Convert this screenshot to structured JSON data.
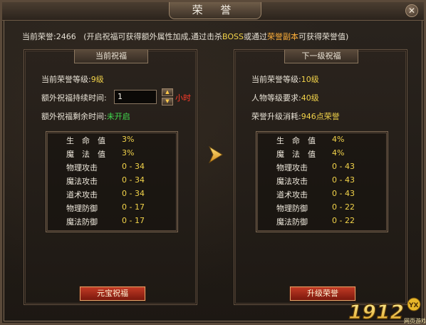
{
  "window": {
    "title": "荣 誉",
    "close": "✕"
  },
  "header": {
    "honor_label": "当前荣誉:",
    "honor_value": "2466",
    "note_prefix": "(开启祝福可获得额外属性加成,通过击杀",
    "note_boss": "BOSS",
    "note_mid": "或通过",
    "note_dungeon": "荣誉副本",
    "note_suffix": "可获得荣誉值)"
  },
  "left": {
    "header": "当前祝福",
    "level_label": "当前荣誉等级:",
    "level_value": "9级",
    "duration_label": "额外祝福持续时间:",
    "duration_input": "1",
    "duration_unit": "小时",
    "remain_label": "额外祝福剩余时间:",
    "remain_value": "未开启",
    "stats": [
      {
        "name": "生　命　值",
        "value": "3%"
      },
      {
        "name": "魔　法　值",
        "value": "3%"
      },
      {
        "name": "物理攻击",
        "value": "0 - 34"
      },
      {
        "name": "魔法攻击",
        "value": "0 - 34"
      },
      {
        "name": "道术攻击",
        "value": "0 - 34"
      },
      {
        "name": "物理防御",
        "value": "0 - 17"
      },
      {
        "name": "魔法防御",
        "value": "0 - 17"
      }
    ],
    "button": "元宝祝福"
  },
  "right": {
    "header": "下一级祝福",
    "level_label": "当前荣誉等级:",
    "level_value": "10级",
    "req_label": "人物等级要求:",
    "req_value": "40级",
    "cost_label": "荣誉升级消耗:",
    "cost_value": "946点荣誉",
    "stats": [
      {
        "name": "生　命　值",
        "value": "4%"
      },
      {
        "name": "魔　法　值",
        "value": "4%"
      },
      {
        "name": "物理攻击",
        "value": "0 - 43"
      },
      {
        "name": "魔法攻击",
        "value": "0 - 43"
      },
      {
        "name": "道术攻击",
        "value": "0 - 43"
      },
      {
        "name": "物理防御",
        "value": "0 - 22"
      },
      {
        "name": "魔法防御",
        "value": "0 - 22"
      }
    ],
    "button": "升级荣誉"
  },
  "logo": {
    "number": "1912",
    "badge": "YX",
    "sub": "网页游戏"
  },
  "colors": {
    "gold": "#f2d34a",
    "red": "#ff3b2a",
    "green": "#41d94d",
    "button": "#c23a24"
  },
  "icons": {
    "close": "close-icon",
    "arrow": "arrow-right-icon",
    "spin_up": "spin-up-icon",
    "spin_down": "spin-down-icon"
  }
}
